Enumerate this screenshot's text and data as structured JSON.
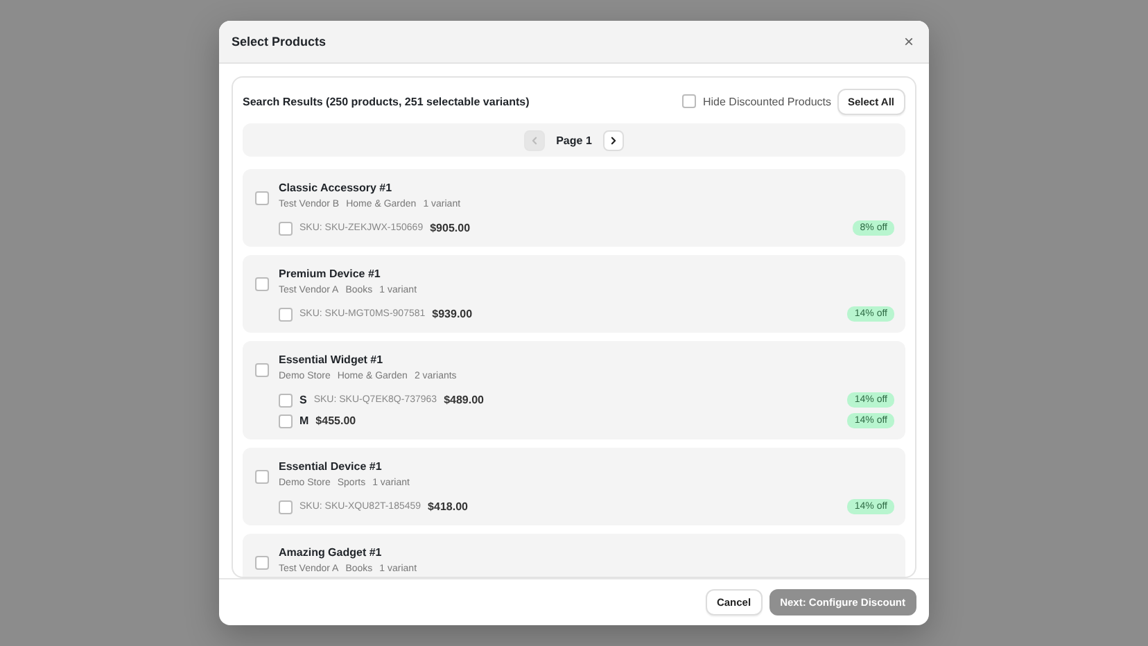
{
  "dialog": {
    "title": "Select Products",
    "close_label": "×"
  },
  "results": {
    "summary": "Search Results (250 products, 251 selectable variants)",
    "hide_discounted": {
      "label": "Hide Discounted Products",
      "checked": false
    },
    "select_all": "Select All"
  },
  "pagination": {
    "page_label": "Page 1",
    "prev_disabled": true,
    "next_disabled": false
  },
  "products": [
    {
      "name": "Classic Accessory #1",
      "checked": false,
      "meta": [
        "Test Vendor B",
        "Home & Garden",
        "1 variant"
      ],
      "variants": [
        {
          "checked": false,
          "sku": "SKU: SKU-ZEKJWX-150669",
          "price": "$905.00",
          "discount": "8% off"
        }
      ]
    },
    {
      "name": "Premium Device #1",
      "checked": false,
      "meta": [
        "Test Vendor A",
        "Books",
        "1 variant"
      ],
      "variants": [
        {
          "checked": false,
          "sku": "SKU: SKU-MGT0MS-907581",
          "price": "$939.00",
          "discount": "14% off"
        }
      ]
    },
    {
      "name": "Essential Widget #1",
      "checked": false,
      "meta": [
        "Demo Store",
        "Home & Garden",
        "2 variants"
      ],
      "variants": [
        {
          "checked": false,
          "option": "S",
          "sku": "SKU: SKU-Q7EK8Q-737963",
          "price": "$489.00",
          "discount": "14% off"
        },
        {
          "checked": false,
          "option": "M",
          "price": "$455.00",
          "discount": "14% off"
        }
      ]
    },
    {
      "name": "Essential Device #1",
      "checked": false,
      "meta": [
        "Demo Store",
        "Sports",
        "1 variant"
      ],
      "variants": [
        {
          "checked": false,
          "sku": "SKU: SKU-XQU82T-185459",
          "price": "$418.00",
          "discount": "14% off"
        }
      ]
    },
    {
      "name": "Amazing Gadget #1",
      "checked": false,
      "meta": [
        "Test Vendor A",
        "Books",
        "1 variant"
      ]
    }
  ],
  "footer": {
    "cancel": "Cancel",
    "next": {
      "label": "Next: Configure Discount",
      "disabled": true
    }
  }
}
